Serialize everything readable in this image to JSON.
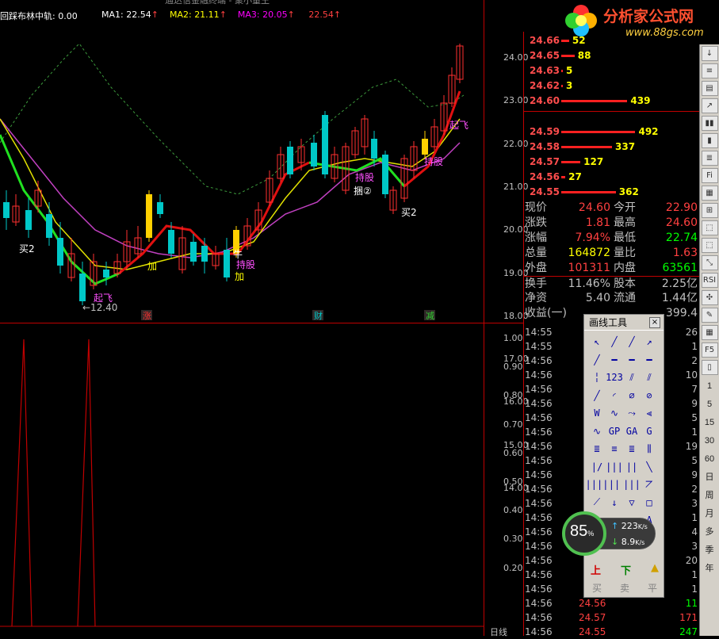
{
  "indicator": {
    "name": "回踩布林中轨",
    "value": "0.00"
  },
  "ma_bar": [
    {
      "label": "MA1:",
      "value": "22.54",
      "color": "#ffffff"
    },
    {
      "label": "MA2:",
      "value": "21.11",
      "color": "#ffff00"
    },
    {
      "label": "MA3:",
      "value": "20.05",
      "color": "#ff00ff"
    },
    {
      "label": "",
      "value": "22.54",
      "color": "#ff4040"
    }
  ],
  "top_title": "通达信金融终端 - 聚小量王",
  "logo": {
    "text": "分析家公式网",
    "url": "www.88gs.com"
  },
  "price_axis": [
    "24.00",
    "23.00",
    "22.00",
    "21.00",
    "20.00",
    "19.00",
    "18.00",
    "17.00",
    "16.00",
    "15.00",
    "14.00"
  ],
  "lower_axis": [
    "1.00",
    "0.90",
    "0.80",
    "0.70",
    "0.60",
    "0.50",
    "0.40",
    "0.30",
    "0.20"
  ],
  "chart_marks": {
    "buy2_left": "买2",
    "buy2_right": "买2",
    "takeoff_low": "起飞",
    "takeoff_high": "起飞",
    "low_price": "←12.40",
    "add1": "加",
    "add2": "加",
    "hold1": "持股",
    "hold2": "持股",
    "hold3": "持股",
    "hold4": "捆②",
    "niu": "牛",
    "tag_zhang": "涨",
    "tag_cai": "财",
    "tag_jian": "减"
  },
  "chart_data": {
    "type": "line",
    "series": [
      {
        "name": "MA1",
        "values": []
      },
      {
        "name": "MA2",
        "values": []
      },
      {
        "name": "MA3",
        "values": []
      }
    ],
    "ylim": [
      12.4,
      24.66
    ],
    "lower_ylim": [
      0,
      1
    ]
  },
  "orderbook": [
    {
      "price": "24.66",
      "vol": "52"
    },
    {
      "price": "24.65",
      "vol": "88"
    },
    {
      "price": "24.63",
      "vol": "5"
    },
    {
      "price": "24.62",
      "vol": "3"
    },
    {
      "price": "24.60",
      "vol": "439"
    },
    {
      "price": "24.59",
      "vol": "492"
    },
    {
      "price": "24.58",
      "vol": "337"
    },
    {
      "price": "24.57",
      "vol": "127"
    },
    {
      "price": "24.56",
      "vol": "27"
    },
    {
      "price": "24.55",
      "vol": "362"
    }
  ],
  "quote": [
    {
      "l1": "现价",
      "v1": "24.60",
      "c1": "#ff4040",
      "l2": "今开",
      "v2": "22.90",
      "c2": "#ff4040"
    },
    {
      "l1": "涨跌",
      "v1": "1.81",
      "c1": "#ff4040",
      "l2": "最高",
      "v2": "24.60",
      "c2": "#ff4040"
    },
    {
      "l1": "涨幅",
      "v1": "7.94%",
      "c1": "#ff4040",
      "l2": "最低",
      "v2": "22.74",
      "c2": "#00ff00"
    },
    {
      "l1": "总量",
      "v1": "164872",
      "c1": "#ffff00",
      "l2": "量比",
      "v2": "1.63",
      "c2": "#ff4040"
    },
    {
      "l1": "外盘",
      "v1": "101311",
      "c1": "#ff4040",
      "l2": "内盘",
      "v2": "63561",
      "c2": "#00ff00"
    },
    {
      "l1": "换手",
      "v1": "11.46%",
      "c1": "#c0c0c0",
      "l2": "股本",
      "v2": "2.25亿",
      "c2": "#c0c0c0"
    },
    {
      "l1": "净资",
      "v1": "5.40",
      "c1": "#c0c0c0",
      "l2": "流通",
      "v2": "1.44亿",
      "c2": "#c0c0c0"
    },
    {
      "l1": "收益(一)",
      "v1": "",
      "c1": "#c0c0c0",
      "l2": "",
      "v2": "399.4",
      "c2": "#c0c0c0"
    }
  ],
  "trades": [
    {
      "t": "14:55",
      "p": "",
      "v": "26"
    },
    {
      "t": "14:55",
      "p": "",
      "v": "1"
    },
    {
      "t": "14:56",
      "p": "",
      "v": "2"
    },
    {
      "t": "14:56",
      "p": "",
      "v": "10"
    },
    {
      "t": "14:56",
      "p": "",
      "v": "7"
    },
    {
      "t": "14:56",
      "p": "",
      "v": "9"
    },
    {
      "t": "14:56",
      "p": "",
      "v": "5"
    },
    {
      "t": "14:56",
      "p": "",
      "v": "1"
    },
    {
      "t": "14:56",
      "p": "",
      "v": "19"
    },
    {
      "t": "14:56",
      "p": "",
      "v": "5"
    },
    {
      "t": "14:56",
      "p": "",
      "v": "9"
    },
    {
      "t": "14:56",
      "p": "",
      "v": "2"
    },
    {
      "t": "14:56",
      "p": "",
      "v": "3"
    },
    {
      "t": "14:56",
      "p": "",
      "v": "1"
    },
    {
      "t": "14:56",
      "p": "",
      "v": "4"
    },
    {
      "t": "14:56",
      "p": "",
      "v": "3"
    },
    {
      "t": "14:56",
      "p": "",
      "v": "20"
    },
    {
      "t": "14:56",
      "p": "",
      "v": "1"
    },
    {
      "t": "14:56",
      "p": "",
      "v": "1"
    },
    {
      "t": "14:56",
      "p": "24.56",
      "v": "11"
    },
    {
      "t": "14:56",
      "p": "24.57",
      "v": "171"
    },
    {
      "t": "14:56",
      "p": "24.55",
      "v": "247"
    }
  ],
  "right_toolbar": [
    "1",
    "5",
    "15",
    "30",
    "60",
    "日",
    "周",
    "月",
    "多",
    "季",
    "年"
  ],
  "tool_panel": {
    "title": "画线工具",
    "close": "×",
    "buttons": [
      "买",
      "卖",
      "平"
    ]
  },
  "net": {
    "percent": "85",
    "unit": "%",
    "up": "223",
    "up_unit": "K/s",
    "down": "8.9",
    "down_unit": "K/s"
  },
  "bottom_label": "日线"
}
